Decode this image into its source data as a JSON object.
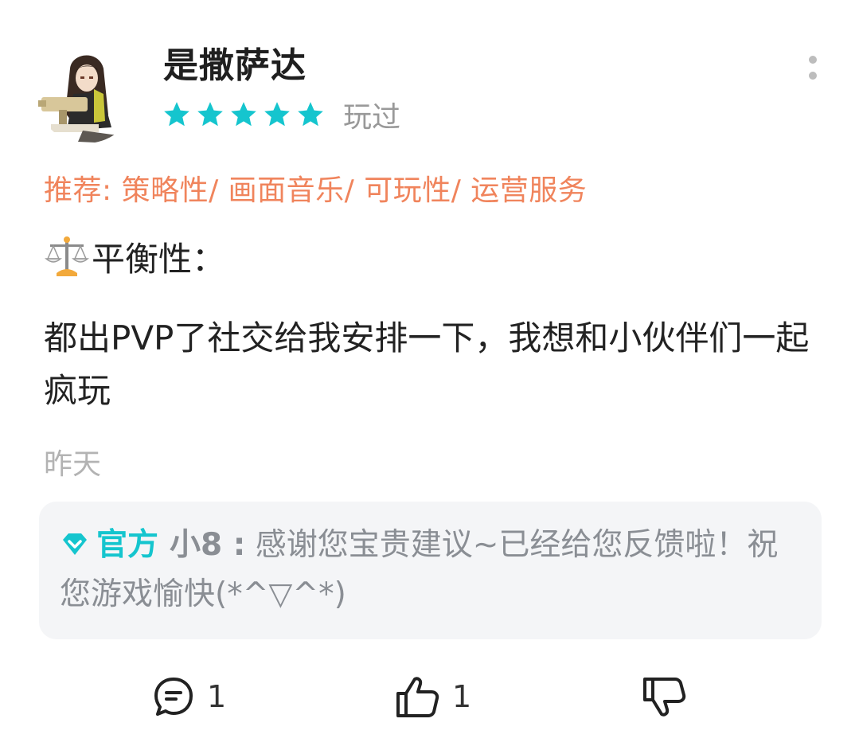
{
  "review": {
    "username": "是撒萨达",
    "rating": 5,
    "rating_max": 5,
    "status": "玩过",
    "tags_text": "推荐: 策略性/ 画面音乐/ 可玩性/ 运营服务",
    "balance_label": "平衡性：",
    "balance_icon": "balance-scale-icon",
    "body": "都出PVP了社交给我安排一下，我想和小伙伴们一起疯玩",
    "time": "昨天"
  },
  "official_reply": {
    "badge_icon": "official-diamond-icon",
    "label": "官方",
    "name": "小8 :",
    "text": "感谢您宝贵建议~已经给您反馈啦！祝您游戏愉快(*^▽^*)"
  },
  "actions": {
    "comment_icon": "comment-icon",
    "comment_count": "1",
    "like_icon": "thumbs-up-icon",
    "like_count": "1",
    "dislike_icon": "thumbs-down-icon"
  },
  "colors": {
    "accent": "#15c5ce",
    "star": "#15c5ce",
    "tags": "#f0845c",
    "muted": "#999999",
    "reply_bg": "#f4f5f7"
  }
}
